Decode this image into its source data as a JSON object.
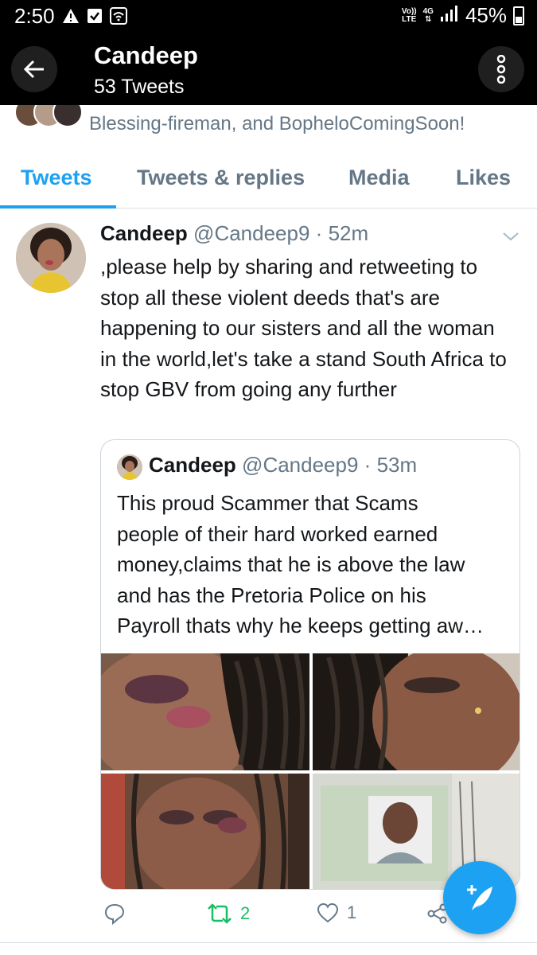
{
  "status_bar": {
    "time": "2:50",
    "volte_line1": "Vo))",
    "volte_line2": "LTE",
    "net_line1": "4G",
    "net_line2": "⇅",
    "battery": "45%"
  },
  "header": {
    "title": "Candeep",
    "subtitle": "53 Tweets"
  },
  "followed_by": {
    "text": "Blessing-fireman, and BopheloComingSoon!"
  },
  "tabs": [
    {
      "label": "Tweets",
      "active": true
    },
    {
      "label": "Tweets & replies",
      "active": false
    },
    {
      "label": "Media",
      "active": false
    },
    {
      "label": "Likes",
      "active": false
    }
  ],
  "tweet": {
    "name": "Candeep",
    "handle": "@Candeep9",
    "dot": "·",
    "time": "52m",
    "text": ",please help by sharing and retweeting to stop all these violent deeds that's are happening to our sisters and all the woman in the world,let's take a stand South Africa to stop GBV from going any further",
    "quote": {
      "name": "Candeep",
      "handle": "@Candeep9",
      "dot": "·",
      "time": "53m",
      "lines": [
        "This proud Scammer that Scams",
        "people of their hard worked earned",
        "money,claims that he is above the law",
        "and has the Pretoria Police on his",
        "Payroll thats why he keeps getting aw…"
      ],
      "photos": [
        "injured-face-photo-1",
        "injured-face-photo-2",
        "injured-face-photo-3",
        "id-document-photo"
      ]
    },
    "actions": {
      "reply_count": "",
      "retweet_count": "2",
      "like_count": "1"
    }
  },
  "colors": {
    "accent": "#1da1f2",
    "retweet": "#17bf63",
    "muted": "#657786",
    "text": "#14171a"
  }
}
